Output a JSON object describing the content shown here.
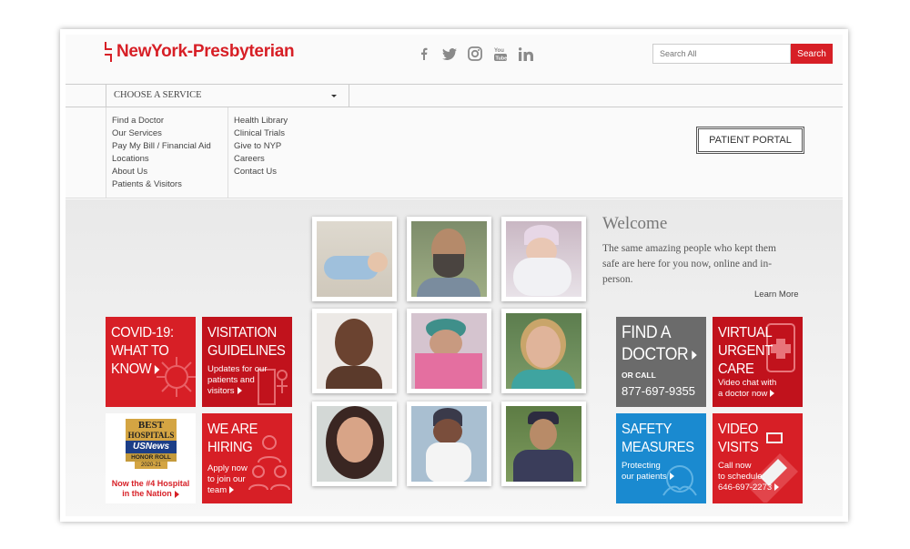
{
  "header": {
    "logo": "NewYork-Presbyterian",
    "social": [
      "facebook-icon",
      "twitter-icon",
      "instagram-icon",
      "youtube-icon",
      "linkedin-icon"
    ],
    "search_placeholder": "Search All",
    "search_label": "Search"
  },
  "service_select": {
    "label": "CHOOSE A SERVICE"
  },
  "menu": {
    "col1": [
      "Find a Doctor",
      "Our Services",
      "Pay My Bill / Financial Aid",
      "Locations",
      "About Us",
      "Patients & Visitors"
    ],
    "col2": [
      "Health Library",
      "Clinical Trials",
      "Give to NYP",
      "Careers",
      "Contact Us"
    ]
  },
  "portal_label": "PATIENT PORTAL",
  "welcome": {
    "title": "Welcome",
    "text": "The same amazing people who kept them safe are here for you now, online and in-person.",
    "link": "Learn More"
  },
  "tiles": {
    "covid": {
      "line1": "COVID-19:",
      "line2": "WHAT TO",
      "line3": "KNOW"
    },
    "visitation": {
      "line1": "VISITATION",
      "line2": "GUIDELINES",
      "sub1": "Updates for our",
      "sub2": "patients and",
      "sub3": "visitors"
    },
    "best": {
      "badge1": "BEST",
      "badge2": "HOSPITALS",
      "badge3": "USNews",
      "badge4": "HONOR ROLL",
      "badge5": "2020-21",
      "caption1": "Now the #4 Hospital",
      "caption2": "in the Nation"
    },
    "hiring": {
      "line1": "WE ARE",
      "line2": "HIRING",
      "sub1": "Apply now",
      "sub2": "to join our",
      "sub3": "team"
    },
    "find": {
      "line1": "FIND A",
      "line2": "DOCTOR",
      "or": "OR CALL",
      "phone": "877-697-9355"
    },
    "virtual": {
      "line1": "VIRTUAL",
      "line2": "URGENT",
      "line3": "CARE",
      "sub1": "Video chat with",
      "sub2": "a doctor now"
    },
    "safety": {
      "line1": "SAFETY",
      "line2": "MEASURES",
      "sub1": "Protecting",
      "sub2": "our patients"
    },
    "video": {
      "line1": "VIDEO",
      "line2": "VISITS",
      "sub1": "Call now",
      "sub2": "to schedule:",
      "sub3": "646-697-2273"
    }
  },
  "colors": {
    "brand_red": "#d71f26",
    "tile_gray": "#6b6b6b",
    "tile_blue": "#1a8ad0"
  }
}
